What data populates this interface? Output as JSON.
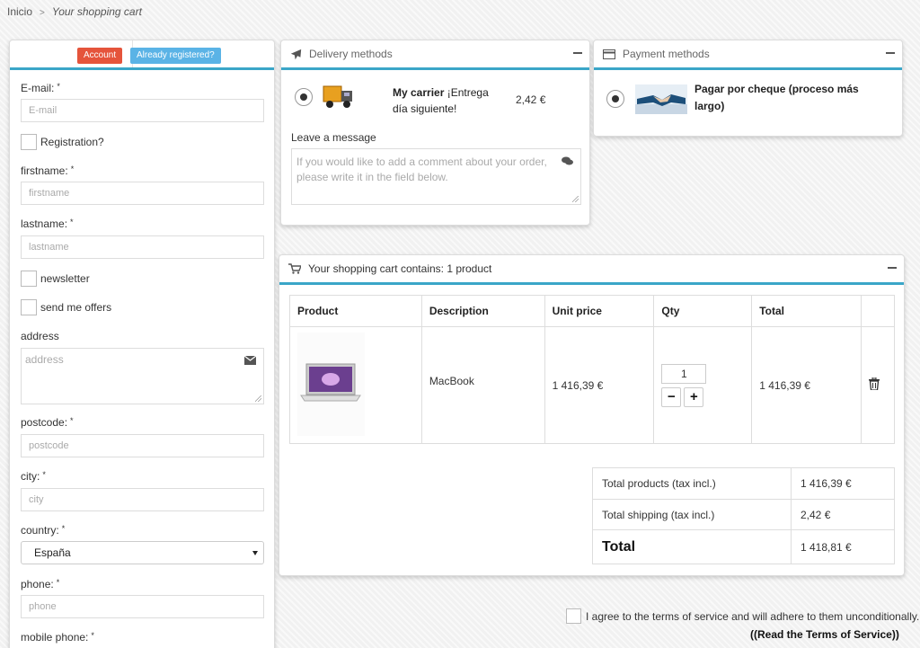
{
  "breadcrumb": {
    "home": "Inicio",
    "separator": ">",
    "current": "Your shopping cart"
  },
  "account": {
    "tab_account": "Account",
    "tab_registered": "Already registered?",
    "required_mark": "*",
    "email_label": "E-mail:",
    "email_placeholder": "E-mail",
    "registration_label": "Registration?",
    "firstname_label": "firstname:",
    "firstname_placeholder": "firstname",
    "lastname_label": "lastname:",
    "lastname_placeholder": "lastname",
    "newsletter_label": "newsletter",
    "offers_label": "send me offers",
    "address_label": "address",
    "address_placeholder": "address",
    "postcode_label": "postcode:",
    "postcode_placeholder": "postcode",
    "city_label": "city:",
    "city_placeholder": "city",
    "country_label": "country:",
    "country_value": "España",
    "phone_label": "phone:",
    "phone_placeholder": "phone",
    "mobile_label": "mobile phone:"
  },
  "delivery": {
    "title": "Delivery methods",
    "carrier_name": "My carrier",
    "carrier_desc": "¡Entrega día siguiente!",
    "carrier_price": "2,42 €",
    "message_label": "Leave a message",
    "message_placeholder": "If you would like to add a comment about your order, please write it in the field below."
  },
  "payment": {
    "title": "Payment methods",
    "option_label": "Pagar por cheque (proceso más largo)"
  },
  "cart": {
    "title": "Your shopping cart contains: 1 product",
    "columns": [
      "Product",
      "Description",
      "Unit price",
      "Qty",
      "Total"
    ],
    "rows": [
      {
        "description": "MacBook",
        "unit_price": "1 416,39 €",
        "qty": "1",
        "total": "1 416,39 €"
      }
    ],
    "qty_minus": "−",
    "qty_plus": "+",
    "totals": [
      {
        "label": "Total products (tax incl.)",
        "value": "1 416,39 €"
      },
      {
        "label": "Total shipping (tax incl.)",
        "value": "2,42 €"
      },
      {
        "label": "Total",
        "value": "1 418,81 €"
      }
    ]
  },
  "terms": {
    "agree_text": "I agree to the terms of service and will adhere to them unconditionally.",
    "read_link": "((Read the Terms of Service))"
  },
  "colors": {
    "accent": "#3aa6c8",
    "account_tab": "#e5543b",
    "registered_tab": "#5ab3e6"
  }
}
